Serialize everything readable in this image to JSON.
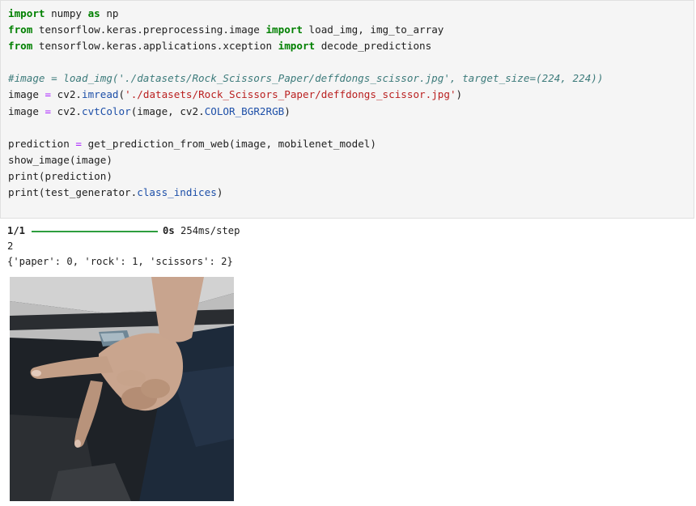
{
  "code_cell": {
    "lines": [
      [
        {
          "t": "import",
          "c": "kw"
        },
        {
          "t": " numpy ",
          "c": "plain"
        },
        {
          "t": "as",
          "c": "kw"
        },
        {
          "t": " np",
          "c": "plain"
        }
      ],
      [
        {
          "t": "from",
          "c": "kw"
        },
        {
          "t": " tensorflow.keras.preprocessing.image ",
          "c": "plain"
        },
        {
          "t": "import",
          "c": "kw"
        },
        {
          "t": " load_img, img_to_array",
          "c": "plain"
        }
      ],
      [
        {
          "t": "from",
          "c": "kw"
        },
        {
          "t": " tensorflow.keras.applications.xception ",
          "c": "plain"
        },
        {
          "t": "import",
          "c": "kw"
        },
        {
          "t": " decode_predictions",
          "c": "plain"
        }
      ],
      [],
      [
        {
          "t": "#image = load_img('./datasets/Rock_Scissors_Paper/deffdongs_scissor.jpg', target_size=(224, 224))",
          "c": "cm"
        }
      ],
      [
        {
          "t": "image ",
          "c": "plain"
        },
        {
          "t": "=",
          "c": "op"
        },
        {
          "t": " cv2.",
          "c": "plain"
        },
        {
          "t": "imread",
          "c": "attr"
        },
        {
          "t": "(",
          "c": "plain"
        },
        {
          "t": "'./datasets/Rock_Scissors_Paper/deffdongs_scissor.jpg'",
          "c": "str"
        },
        {
          "t": ")",
          "c": "plain"
        }
      ],
      [
        {
          "t": "image ",
          "c": "plain"
        },
        {
          "t": "=",
          "c": "op"
        },
        {
          "t": " cv2.",
          "c": "plain"
        },
        {
          "t": "cvtColor",
          "c": "attr"
        },
        {
          "t": "(image, cv2.",
          "c": "plain"
        },
        {
          "t": "COLOR_BGR2RGB",
          "c": "attr"
        },
        {
          "t": ")",
          "c": "plain"
        }
      ],
      [],
      [
        {
          "t": "prediction ",
          "c": "plain"
        },
        {
          "t": "=",
          "c": "op"
        },
        {
          "t": " get_prediction_from_web(image, mobilenet_model)",
          "c": "plain"
        }
      ],
      [
        {
          "t": "show_image(image)",
          "c": "plain"
        }
      ],
      [
        {
          "t": "print(prediction)",
          "c": "plain"
        }
      ],
      [
        {
          "t": "print(test_generator.",
          "c": "plain"
        },
        {
          "t": "class_indices",
          "c": "attr"
        },
        {
          "t": ")",
          "c": "plain"
        }
      ]
    ]
  },
  "output": {
    "progress_step": "1/1",
    "progress_fraction": 1.0,
    "progress_time": "0s",
    "progress_rate": "254ms/step",
    "prediction_value": "2",
    "class_indices_text": "{'paper': 0, 'rock': 1, 'scissors': 2}"
  },
  "image_output": {
    "subject": "hand-scissors-gesture-photo"
  }
}
